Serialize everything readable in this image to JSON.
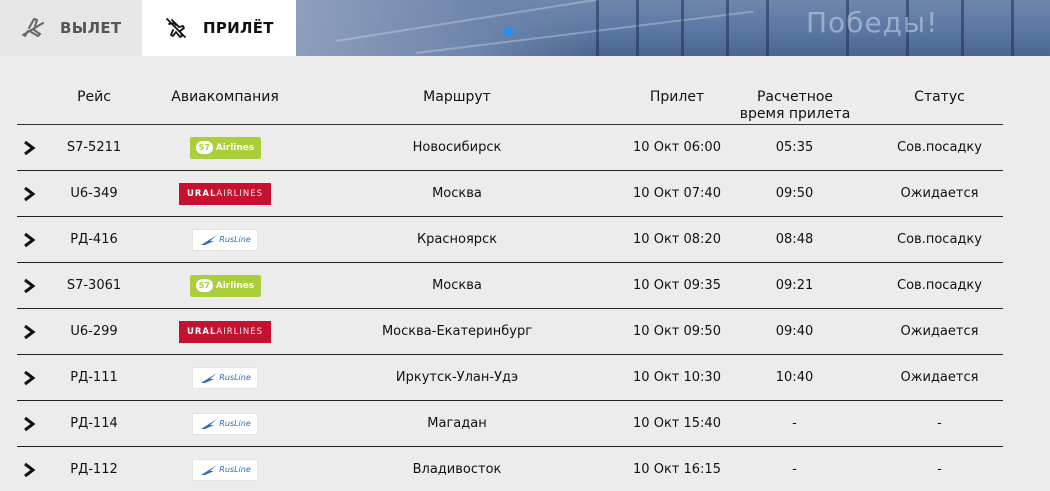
{
  "tabs": {
    "departure": {
      "label": "ВЫЛЕТ",
      "icon": "plane-takeoff-icon"
    },
    "arrival": {
      "label": "ПРИЛЁТ",
      "icon": "plane-landing-icon",
      "active": true
    }
  },
  "banner": {
    "text": "Победы!"
  },
  "table": {
    "columns": {
      "flight": "Рейс",
      "airline": "Авиакомпания",
      "route": "Маршрут",
      "arrival": "Прилет",
      "estimated_line1": "Расчетное",
      "estimated_line2": "время прилета",
      "status": "Статус"
    },
    "rows": [
      {
        "flight": "S7-5211",
        "airline_logo": "S7 Airlines",
        "route": "Новосибирск",
        "arrival": "10 Окт 06:00",
        "estimated": "05:35",
        "status": "Сов.посадку"
      },
      {
        "flight": "U6-349",
        "airline_logo": "URAL AIRLINES",
        "route": "Москва",
        "arrival": "10 Окт 07:40",
        "estimated": "09:50",
        "status": "Ожидается"
      },
      {
        "flight": "РД-416",
        "airline_logo": "RusLine",
        "route": "Красноярск",
        "arrival": "10 Окт 08:20",
        "estimated": "08:48",
        "status": "Сов.посадку"
      },
      {
        "flight": "S7-3061",
        "airline_logo": "S7 Airlines",
        "route": "Москва",
        "arrival": "10 Окт 09:35",
        "estimated": "09:21",
        "status": "Сов.посадку"
      },
      {
        "flight": "U6-299",
        "airline_logo": "URAL AIRLINES",
        "route": "Москва-Екатеринбург",
        "arrival": "10 Окт 09:50",
        "estimated": "09:40",
        "status": "Ожидается"
      },
      {
        "flight": "РД-111",
        "airline_logo": "RusLine",
        "route": "Иркутск-Улан-Удэ",
        "arrival": "10 Окт 10:30",
        "estimated": "10:40",
        "status": "Ожидается"
      },
      {
        "flight": "РД-114",
        "airline_logo": "RusLine",
        "route": "Магадан",
        "arrival": "10 Окт 15:40",
        "estimated": "-",
        "status": "-"
      },
      {
        "flight": "РД-112",
        "airline_logo": "RusLine",
        "route": "Владивосток",
        "arrival": "10 Окт 16:15",
        "estimated": "-",
        "status": "-"
      }
    ]
  },
  "colors": {
    "s7": "#a9cf3a",
    "ural": "#c41230",
    "rusline": "#2a6fb5",
    "carousel_dot": "#1e90ff"
  }
}
